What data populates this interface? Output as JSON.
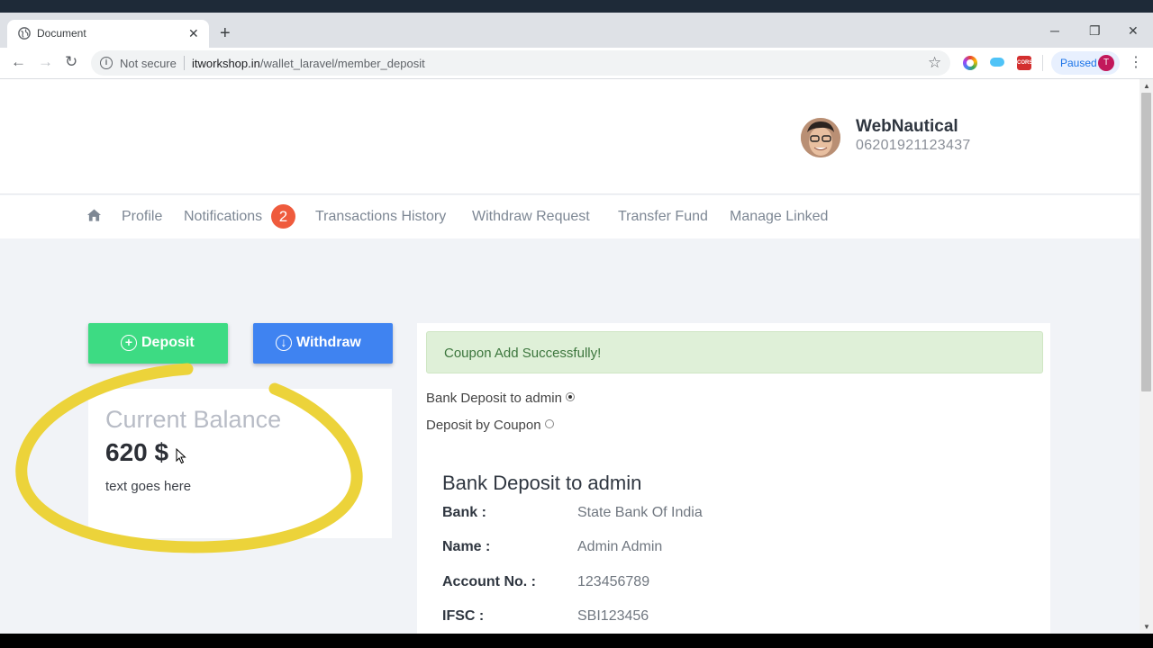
{
  "browser": {
    "tab_title": "Document",
    "new_tab": "+",
    "not_secure": "Not secure",
    "url_host": "itworkshop.in",
    "url_path": "/wallet_laravel/member_deposit",
    "paused_label": "Paused",
    "profile_initial": "T",
    "cors_ext_label": "CORS"
  },
  "user": {
    "name": "WebNautical",
    "id": "06201921123437"
  },
  "nav": {
    "items": [
      {
        "label": "Profile"
      },
      {
        "label": "Notifications",
        "badge": "2"
      },
      {
        "label": "Transactions History"
      },
      {
        "label": "Withdraw Request"
      },
      {
        "label": "Transfer Fund"
      },
      {
        "label": "Manage Linked"
      }
    ]
  },
  "actions": {
    "deposit_label": "Deposit",
    "withdraw_label": "Withdraw"
  },
  "balance": {
    "title": "Current Balance",
    "value": "620 $",
    "note": "text goes here"
  },
  "deposit_panel": {
    "alert": "Coupon Add Successfully!",
    "options": [
      {
        "label": "Bank Deposit to admin",
        "selected": true
      },
      {
        "label": "Deposit by Coupon",
        "selected": false
      }
    ],
    "section_title": "Bank Deposit to admin",
    "details": [
      {
        "label": "Bank :",
        "value": "State Bank Of India"
      },
      {
        "label": "Name :",
        "value": "Admin Admin"
      },
      {
        "label": "Account No. :",
        "value": "123456789"
      },
      {
        "label": "IFSC :",
        "value": "SBI123456"
      }
    ]
  },
  "colors": {
    "deposit_button": "#3ddb83",
    "withdraw_button": "#3f83f1",
    "badge": "#ef5b3d",
    "alert_bg": "#dff0d8",
    "annotation_stroke": "#ecd33a"
  }
}
